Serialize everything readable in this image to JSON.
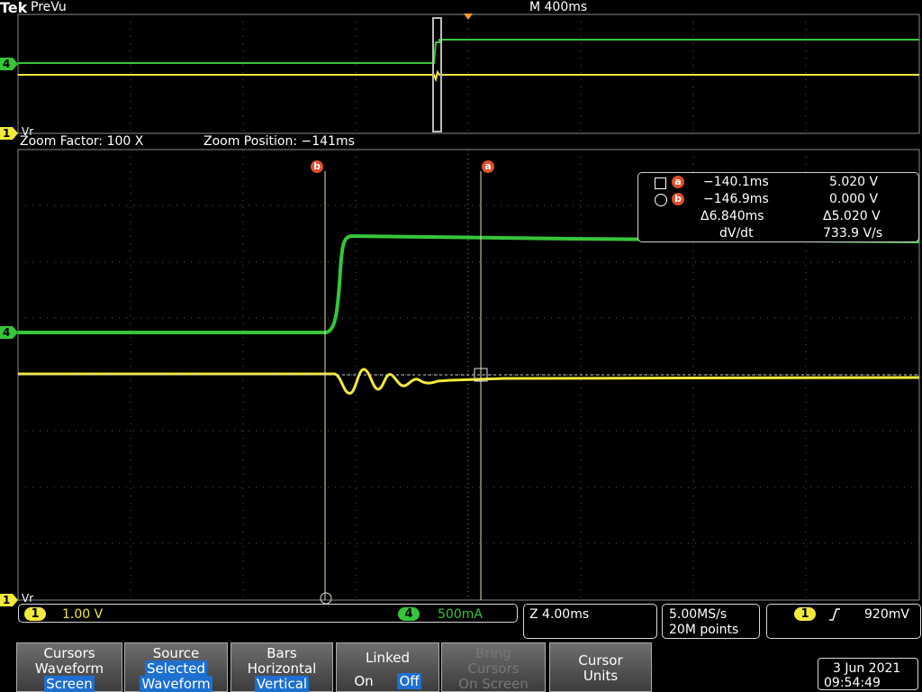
{
  "header": {
    "brand": "Tek",
    "mode": "PreVu",
    "timebase": "M 400ms"
  },
  "zoom": {
    "factor": "Zoom Factor: 100 X",
    "position": "Zoom Position: −141ms"
  },
  "cursor_labels": {
    "a": "a",
    "b": "b"
  },
  "readout": {
    "a_time": "−140.1ms",
    "a_value": "5.020 V",
    "b_time": "−146.9ms",
    "b_value": "0.000 V",
    "delta_time": "Δ6.840ms",
    "delta_value": "Δ5.020 V",
    "rate_label": "dV/dt",
    "rate_value": "733.9 V/s"
  },
  "channels": {
    "ch1": {
      "number": "1",
      "scale": "1.00 V",
      "ref": "Vr",
      "color": "#f2ea3a"
    },
    "ch4": {
      "number": "4",
      "scale": "500mA",
      "color": "#35c63a"
    }
  },
  "status": {
    "zoom_scale": "Z 4.00ms",
    "sample_rate": "5.00MS/s",
    "record": "20M points",
    "trigger_source": "1",
    "trigger_level": "920mV"
  },
  "menu": {
    "cursors": {
      "line1": "Cursors",
      "line2": "Waveform",
      "selected": "Screen"
    },
    "source": {
      "line1": "Source",
      "selected": "Selected",
      "line2": "Waveform"
    },
    "bars": {
      "line1": "Bars",
      "line2": "Horizontal",
      "selected": "Vertical"
    },
    "linked": {
      "title": "Linked",
      "on": "On",
      "off": "Off"
    },
    "bring": {
      "line1": "Bring",
      "line2": "Cursors",
      "line3": "On Screen"
    },
    "units": {
      "line1": "Cursor",
      "line2": "Units"
    }
  },
  "datetime": {
    "date": "3 Jun 2021",
    "time": "09:54:49"
  }
}
